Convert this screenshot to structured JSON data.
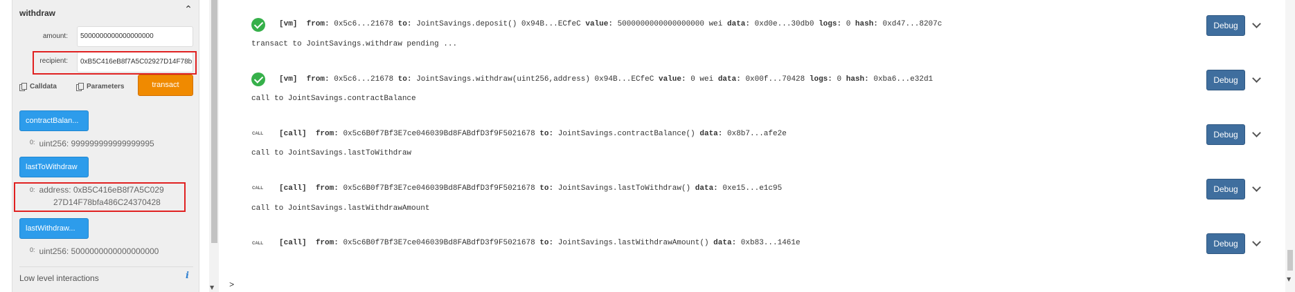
{
  "panel": {
    "function_title": "withdraw",
    "amount_label": "amount:",
    "amount_value": "5000000000000000000",
    "recipient_label": "recipient:",
    "recipient_value": "0xB5C416eB8f7A5C02927D14F78b",
    "calldata_label": "Calldata",
    "parameters_label": "Parameters",
    "transact_label": "transact",
    "contract_balance_button": "contractBalan...",
    "contract_balance_idx": "0:",
    "contract_balance_result": "uint256: 999999999999999995",
    "last_to_withdraw_button": "lastToWithdraw",
    "last_to_withdraw_idx": "0:",
    "last_to_withdraw_result_line1": "address: 0xB5C416eB8f7A5C029",
    "last_to_withdraw_result_line2": "27D14F78bfa486C24370428",
    "last_withdraw_amount_button": "lastWithdraw...",
    "last_withdraw_amount_idx": "0:",
    "last_withdraw_amount_result": "uint256: 5000000000000000000",
    "low_level_label": "Low level interactions",
    "info_icon": "i"
  },
  "terminal": {
    "prompt": ">",
    "debug_label": "Debug",
    "entries": [
      {
        "kind": "vm",
        "badge": "[vm]",
        "from_label": "from:",
        "from": "0x5c6...21678",
        "to_label": "to:",
        "to": "JointSavings.deposit() 0x94B...ECfeC",
        "value_label": "value:",
        "value": "5000000000000000000 wei",
        "data_label": "data:",
        "data": "0xd0e...30db0",
        "logs_label": "logs:",
        "logs": "0",
        "hash_label": "hash:",
        "hash": "0xd47...8207c",
        "after": "transact to JointSavings.withdraw pending ..."
      },
      {
        "kind": "vm",
        "badge": "[vm]",
        "from_label": "from:",
        "from": "0x5c6...21678",
        "to_label": "to:",
        "to": "JointSavings.withdraw(uint256,address) 0x94B...ECfeC",
        "value_label": "value:",
        "value": "0 wei",
        "data_label": "data:",
        "data": "0x00f...70428",
        "logs_label": "logs:",
        "logs": "0",
        "hash_label": "hash:",
        "hash": "0xba6...e32d1",
        "after": "call to JointSavings.contractBalance"
      },
      {
        "kind": "call",
        "call_badge": "CALL",
        "badge": "[call]",
        "from_label": "from:",
        "from": "0x5c6B0f7Bf3E7ce046039Bd8FABdfD3f9F5021678",
        "to_label": "to:",
        "to": "JointSavings.contractBalance()",
        "data_label": "data:",
        "data": "0x8b7...afe2e",
        "after": "call to JointSavings.lastToWithdraw"
      },
      {
        "kind": "call",
        "call_badge": "CALL",
        "badge": "[call]",
        "from_label": "from:",
        "from": "0x5c6B0f7Bf3E7ce046039Bd8FABdfD3f9F5021678",
        "to_label": "to:",
        "to": "JointSavings.lastToWithdraw()",
        "data_label": "data:",
        "data": "0xe15...e1c95",
        "after": "call to JointSavings.lastWithdrawAmount"
      },
      {
        "kind": "call",
        "call_badge": "CALL",
        "badge": "[call]",
        "from_label": "from:",
        "from": "0x5c6B0f7Bf3E7ce046039Bd8FABdfD3f9F5021678",
        "to_label": "to:",
        "to": "JointSavings.lastWithdrawAmount()",
        "data_label": "data:",
        "data": "0xb83...1461e"
      }
    ]
  }
}
